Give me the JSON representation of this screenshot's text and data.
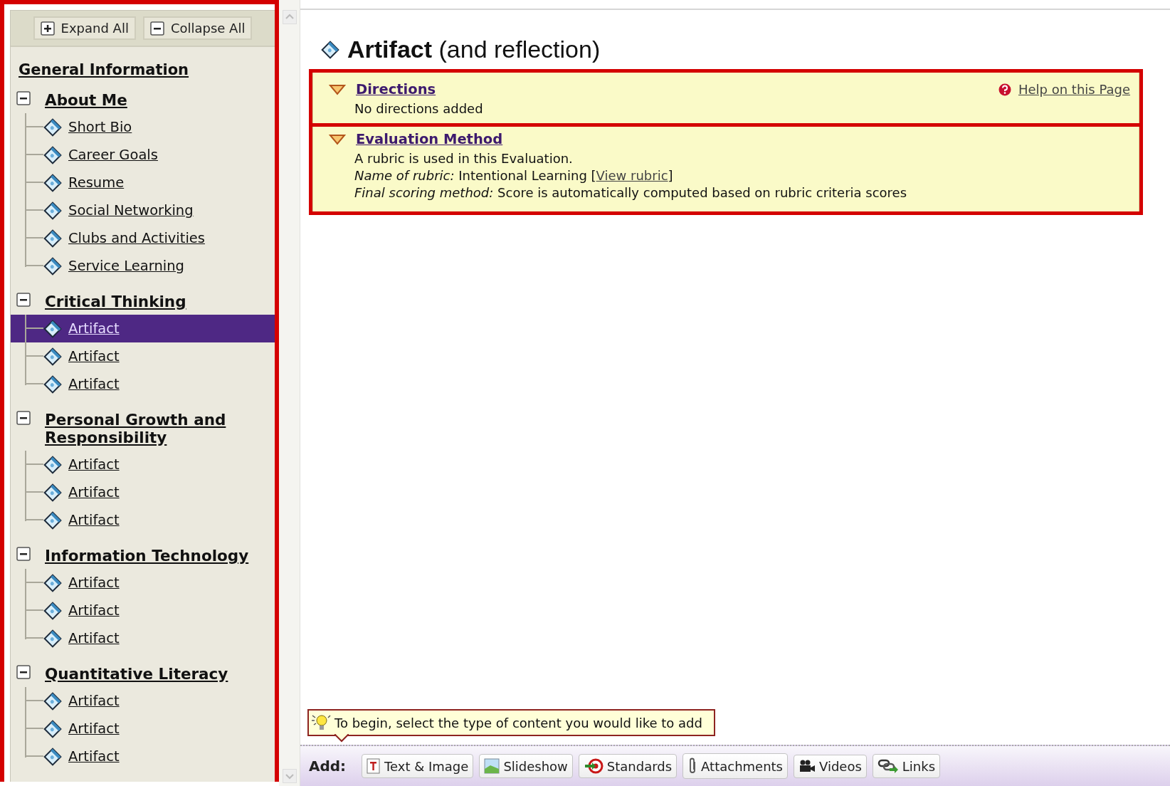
{
  "sidebar": {
    "buttons": [
      {
        "kind": "expand",
        "label": "Expand All"
      },
      {
        "kind": "collapse",
        "label": "Collapse All"
      }
    ],
    "general": "General Information",
    "sections": [
      {
        "title": "About Me",
        "expanded": true,
        "children": [
          {
            "label": "Short Bio",
            "selected": false
          },
          {
            "label": "Career Goals",
            "selected": false
          },
          {
            "label": "Resume",
            "selected": false
          },
          {
            "label": "Social Networking",
            "selected": false
          },
          {
            "label": "Clubs and Activities",
            "selected": false
          },
          {
            "label": "Service Learning",
            "selected": false
          }
        ]
      },
      {
        "title": "Critical Thinking",
        "expanded": true,
        "children": [
          {
            "label": "Artifact",
            "selected": true
          },
          {
            "label": "Artifact",
            "selected": false
          },
          {
            "label": "Artifact",
            "selected": false
          }
        ]
      },
      {
        "title": "Personal Growth and Responsibility",
        "expanded": true,
        "children": [
          {
            "label": "Artifact",
            "selected": false
          },
          {
            "label": "Artifact",
            "selected": false
          },
          {
            "label": "Artifact",
            "selected": false
          }
        ]
      },
      {
        "title": "Information Technology",
        "expanded": true,
        "children": [
          {
            "label": "Artifact",
            "selected": false
          },
          {
            "label": "Artifact",
            "selected": false
          },
          {
            "label": "Artifact",
            "selected": false
          }
        ]
      },
      {
        "title": "Quantitative Literacy",
        "expanded": true,
        "children": [
          {
            "label": "Artifact",
            "selected": false
          },
          {
            "label": "Artifact",
            "selected": false
          },
          {
            "label": "Artifact",
            "selected": false
          }
        ]
      }
    ]
  },
  "page": {
    "title": "Artifact",
    "subtitle": "(and reflection)"
  },
  "directions": {
    "title": "Directions",
    "expanded": true,
    "help": "Help on this Page",
    "body": "No directions added"
  },
  "evaluation": {
    "title": "Evaluation Method",
    "expanded": true,
    "intro": "A rubric is used in this Evaluation.",
    "rubric_prefix": "*Name of rubric:* Intentional Learning [",
    "rubric_link": "View rubric",
    "rubric_suffix": "]",
    "scoring": "*Final scoring method:* Score is automatically computed based on rubric criteria scores"
  },
  "tooltip": "To begin, select the type of content you would like to add",
  "toolbar": {
    "label": "Add:",
    "buttons": [
      {
        "kind": "text",
        "label": "Text & Image"
      },
      {
        "kind": "slideshow",
        "label": "Slideshow"
      },
      {
        "kind": "standards",
        "label": "Standards"
      },
      {
        "kind": "attachments",
        "label": "Attachments"
      },
      {
        "kind": "videos",
        "label": "Videos"
      },
      {
        "kind": "links",
        "label": "Links"
      }
    ]
  }
}
